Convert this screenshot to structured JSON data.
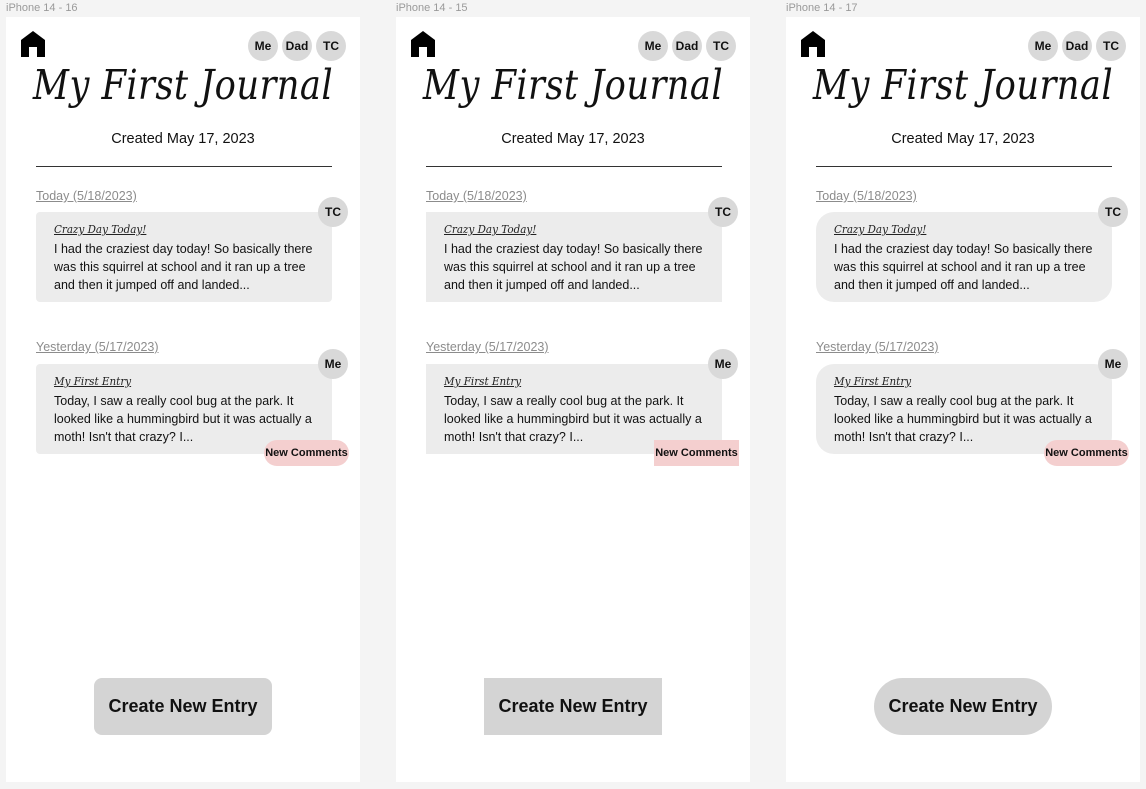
{
  "frames": [
    {
      "label": "iPhone 14 - 16",
      "avatars": [
        "Me",
        "Dad",
        "TC"
      ],
      "title": "My First Journal",
      "created": "Created May 17, 2023",
      "entries": [
        {
          "date": "Today (5/18/2023)",
          "title": "Crazy Day Today!",
          "body": "I had the craziest day today! So basically there was this squirrel at school and it ran up a tree and then it jumped off and landed...",
          "author": "TC",
          "badge": ""
        },
        {
          "date": "Yesterday (5/17/2023)",
          "title": "My First Entry",
          "body": "Today, I saw a really cool bug at the park. It looked like a hummingbird but it was actually a moth! Isn't that crazy? I...",
          "author": "Me",
          "badge": "New Comments"
        }
      ],
      "button": "Create New Entry"
    },
    {
      "label": "iPhone 14 - 15",
      "avatars": [
        "Me",
        "Dad",
        "TC"
      ],
      "title": "My First Journal",
      "created": "Created May 17, 2023",
      "entries": [
        {
          "date": "Today (5/18/2023)",
          "title": "Crazy Day Today!",
          "body": "I had the craziest day today! So basically there was this squirrel at school and it ran up a tree and then it jumped off and landed...",
          "author": "TC",
          "badge": ""
        },
        {
          "date": "Yesterday (5/17/2023)",
          "title": "My First Entry",
          "body": "Today, I saw a really cool bug at the park. It looked like a hummingbird but it was actually a moth! Isn't that crazy? I...",
          "author": "Me",
          "badge": "New Comments"
        }
      ],
      "button": "Create New Entry"
    },
    {
      "label": "iPhone 14 - 17",
      "avatars": [
        "Me",
        "Dad",
        "TC"
      ],
      "title": "My First Journal",
      "created": "Created May 17, 2023",
      "entries": [
        {
          "date": "Today (5/18/2023)",
          "title": "Crazy Day Today!",
          "body": "I had the craziest day today! So basically there was this squirrel at school and it ran up a tree and then it jumped off and landed...",
          "author": "TC",
          "badge": ""
        },
        {
          "date": "Yesterday (5/17/2023)",
          "title": "My First Entry",
          "body": "Today, I saw a really cool bug at the park. It looked like a hummingbird but it was actually a moth! Isn't that crazy? I...",
          "author": "Me",
          "badge": "New Comments"
        }
      ],
      "button": "Create New Entry"
    }
  ],
  "colors": {
    "canvas": "#f4f4f4",
    "card": "#ececec",
    "avatar": "#d9d9d9",
    "badge": "#f4cfcf",
    "button": "#d4d4d4"
  }
}
